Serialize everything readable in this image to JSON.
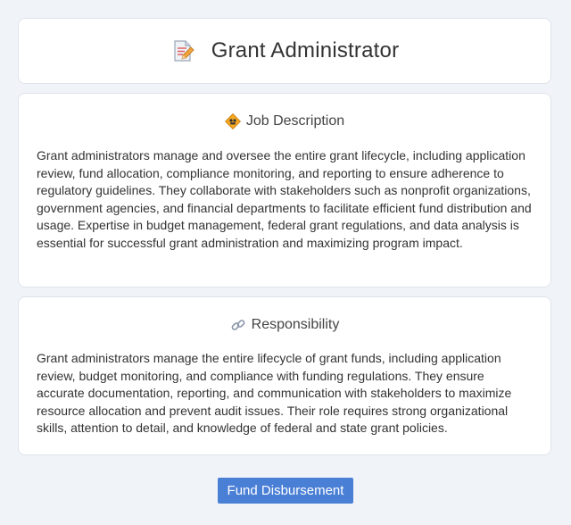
{
  "header": {
    "title": "Grant Administrator",
    "icon": "document-pencil-icon"
  },
  "job_description": {
    "heading": "Job Description",
    "icon": "badge-icon",
    "text": "Grant administrators manage and oversee the entire grant lifecycle, including application review, fund allocation, compliance monitoring, and reporting to ensure adherence to regulatory guidelines. They collaborate with stakeholders such as nonprofit organizations, government agencies, and financial departments to facilitate efficient fund distribution and usage. Expertise in budget management, federal grant regulations, and data analysis is essential for successful grant administration and maximizing program impact."
  },
  "responsibility": {
    "heading": "Responsibility",
    "icon": "link-icon",
    "text": "Grant administrators manage the entire lifecycle of grant funds, including application review, budget monitoring, and compliance with funding regulations. They ensure accurate documentation, reporting, and communication with stakeholders to maximize resource allocation and prevent audit issues. Their role requires strong organizational skills, attention to detail, and knowledge of federal and state grant policies."
  },
  "tag": {
    "label": "Fund Disbursement",
    "color": "#4a7fd6"
  }
}
